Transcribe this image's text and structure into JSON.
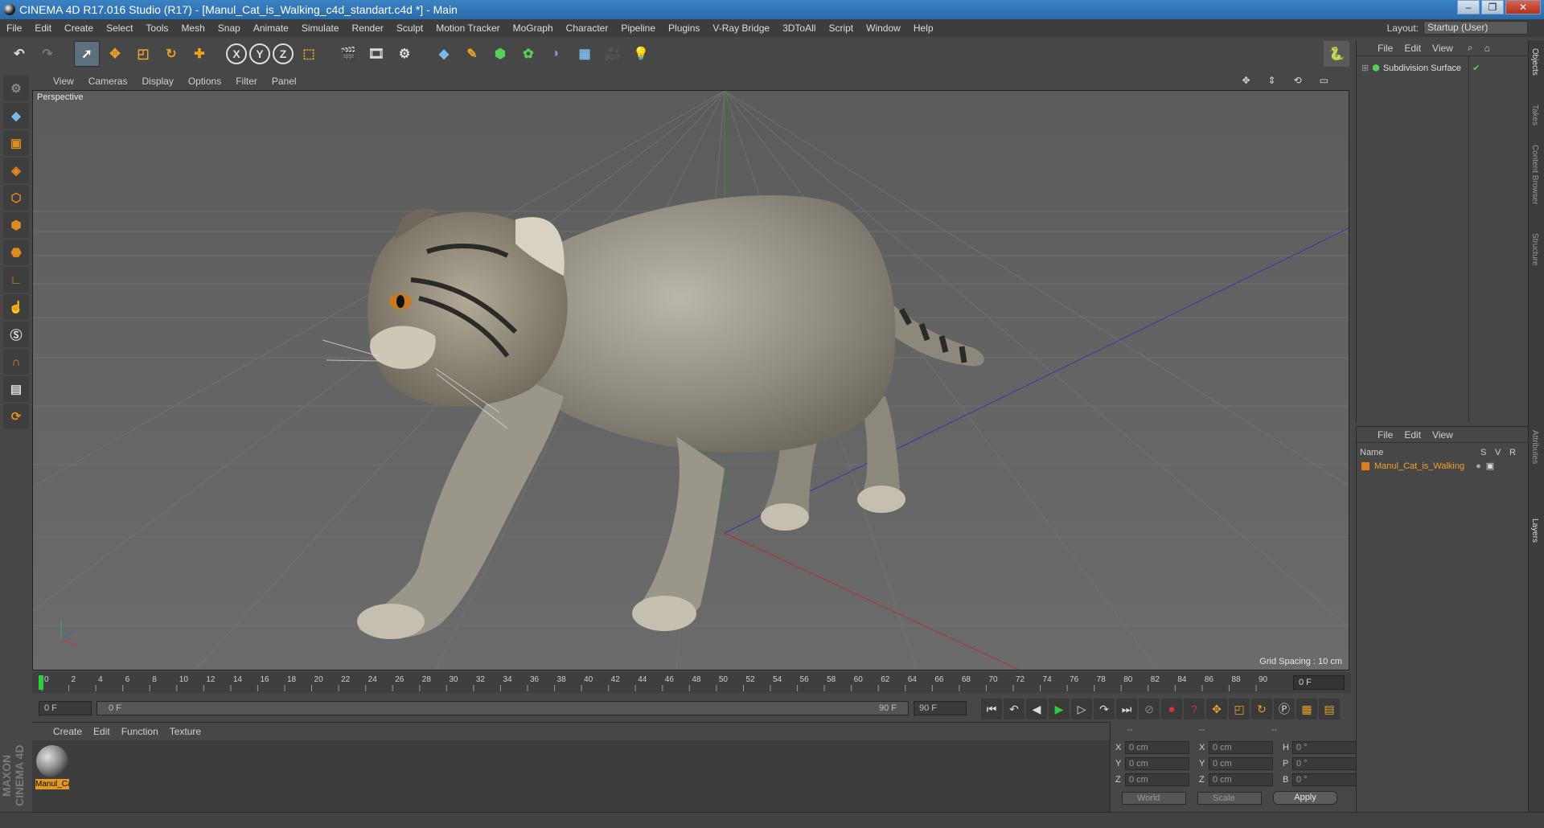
{
  "window": {
    "title": "CINEMA 4D R17.016 Studio (R17) - [Manul_Cat_is_Walking_c4d_standart.c4d *] - Main",
    "controls": [
      "–",
      "❐",
      "✕"
    ]
  },
  "menubar": [
    "File",
    "Edit",
    "Create",
    "Select",
    "Tools",
    "Mesh",
    "Snap",
    "Animate",
    "Simulate",
    "Render",
    "Sculpt",
    "Motion Tracker",
    "MoGraph",
    "Character",
    "Pipeline",
    "Plugins",
    "V-Ray Bridge",
    "3DToAll",
    "Script",
    "Window",
    "Help"
  ],
  "layout": {
    "label": "Layout:",
    "value": "Startup (User)"
  },
  "toolbar": {
    "axis_x": "X",
    "axis_y": "Y",
    "axis_z": "Z"
  },
  "viewport": {
    "menu": [
      "View",
      "Cameras",
      "Display",
      "Options",
      "Filter",
      "Panel"
    ],
    "label": "Perspective",
    "grid_spacing": "Grid Spacing : 10 cm"
  },
  "timeline": {
    "ticks": [
      "0",
      "2",
      "4",
      "6",
      "8",
      "10",
      "12",
      "14",
      "16",
      "18",
      "20",
      "22",
      "24",
      "26",
      "28",
      "30",
      "32",
      "34",
      "36",
      "38",
      "40",
      "42",
      "44",
      "46",
      "48",
      "50",
      "52",
      "54",
      "56",
      "58",
      "60",
      "62",
      "64",
      "66",
      "68",
      "70",
      "72",
      "74",
      "76",
      "78",
      "80",
      "82",
      "84",
      "86",
      "88",
      "90"
    ],
    "current_frame": "0 F",
    "start": "0 F",
    "range_start": "0 F",
    "range_end": "90 F",
    "end": "90 F"
  },
  "materials": {
    "menu": [
      "Create",
      "Edit",
      "Function",
      "Texture"
    ],
    "item": "Manul_Cat"
  },
  "coords": {
    "header": [
      "--",
      "--",
      "--"
    ],
    "rows": [
      {
        "a": "X",
        "av": "0 cm",
        "b": "X",
        "bv": "0 cm",
        "c": "H",
        "cv": "0 °"
      },
      {
        "a": "Y",
        "av": "0 cm",
        "b": "Y",
        "bv": "0 cm",
        "c": "P",
        "cv": "0 °"
      },
      {
        "a": "Z",
        "av": "0 cm",
        "b": "Z",
        "bv": "0 cm",
        "c": "B",
        "cv": "0 °"
      }
    ],
    "world": "World",
    "scale": "Scale",
    "apply": "Apply"
  },
  "objects": {
    "menu": [
      "File",
      "Edit",
      "View"
    ],
    "item": "Subdivision Surface"
  },
  "layers": {
    "menu": [
      "File",
      "Edit",
      "View"
    ],
    "cols": [
      "Name",
      "S",
      "V",
      "R"
    ],
    "item": "Manul_Cat_is_Walking"
  },
  "side_tabs": [
    "Objects",
    "Takes",
    "Content Browser",
    "Structure",
    "Attributes",
    "Layers"
  ],
  "maxon_logo": "MAXON CINEMA 4D"
}
